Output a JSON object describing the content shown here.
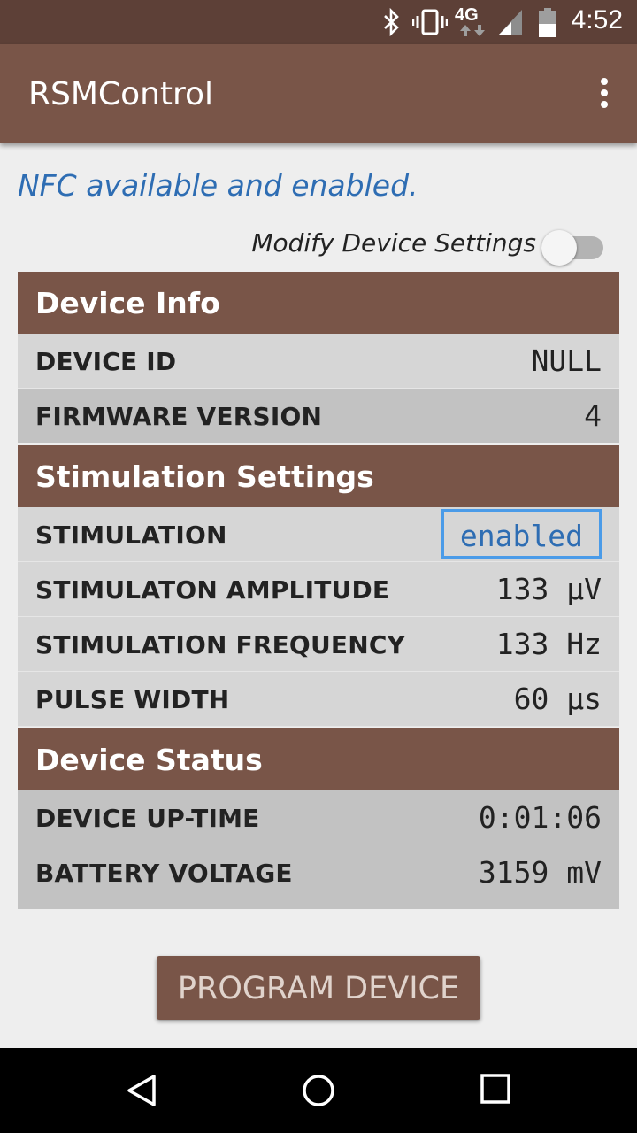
{
  "status_bar": {
    "time": "4:52",
    "network": "4G",
    "icons": [
      "bluetooth-icon",
      "vibrate-icon",
      "network-4g-icon",
      "signal-icon",
      "battery-icon"
    ]
  },
  "app_bar": {
    "title": "RSMControl",
    "menu_icon": "overflow-menu-icon"
  },
  "nfc_status": "NFC available and enabled.",
  "modify_settings": {
    "label": "Modify Device Settings",
    "enabled": false
  },
  "sections": {
    "device_info": {
      "title": "Device Info",
      "rows": [
        {
          "label": "DEVICE ID",
          "value": "NULL"
        },
        {
          "label": "FIRMWARE VERSION",
          "value": "4"
        }
      ]
    },
    "stimulation": {
      "title": "Stimulation Settings",
      "rows": [
        {
          "label": "STIMULATION",
          "value": "enabled"
        },
        {
          "label": "STIMULATON AMPLITUDE",
          "value": "133 µV"
        },
        {
          "label": "STIMULATION FREQUENCY",
          "value": "133 Hz"
        },
        {
          "label": "PULSE WIDTH",
          "value": "60 µs"
        }
      ]
    },
    "device_status": {
      "title": "Device Status",
      "rows": [
        {
          "label": "DEVICE UP-TIME",
          "value": "0:01:06"
        },
        {
          "label": "BATTERY VOLTAGE",
          "value": "3159 mV"
        }
      ]
    }
  },
  "program_button": "PROGRAM DEVICE",
  "nav_bar": {
    "icons": [
      "back-icon",
      "home-icon",
      "recents-icon"
    ]
  },
  "colors": {
    "primary": "#795548",
    "primary_dark": "#5d4037",
    "accent_blue": "#2e6db3",
    "focus_border": "#4a9be8",
    "row_light": "#d6d6d6",
    "row_dark": "#c2c2c2"
  }
}
